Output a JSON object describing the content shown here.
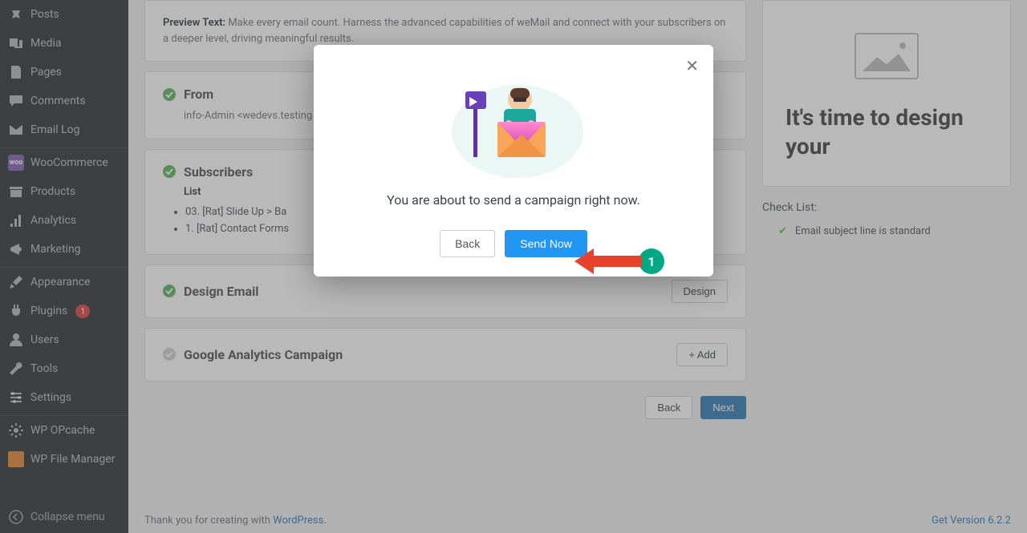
{
  "sidebar": {
    "items": [
      {
        "label": "Posts",
        "icon": "pin"
      },
      {
        "label": "Media",
        "icon": "media"
      },
      {
        "label": "Pages",
        "icon": "page"
      },
      {
        "label": "Comments",
        "icon": "comment"
      },
      {
        "label": "Email Log",
        "icon": "email"
      }
    ],
    "items2": [
      {
        "label": "WooCommerce",
        "icon": "woo"
      },
      {
        "label": "Products",
        "icon": "archive"
      },
      {
        "label": "Analytics",
        "icon": "chart"
      },
      {
        "label": "Marketing",
        "icon": "mega"
      }
    ],
    "items3": [
      {
        "label": "Appearance",
        "icon": "brush"
      },
      {
        "label": "Plugins",
        "icon": "plug",
        "badge": "1"
      },
      {
        "label": "Users",
        "icon": "user"
      },
      {
        "label": "Tools",
        "icon": "wrench"
      },
      {
        "label": "Settings",
        "icon": "sliders"
      }
    ],
    "items4": [
      {
        "label": "WP OPcache",
        "icon": "gear"
      },
      {
        "label": "WP File Manager",
        "icon": "folder"
      }
    ],
    "collapse": "Collapse menu"
  },
  "preview_card": {
    "label": "Preview Text:",
    "text": "Make every email count. Harness the advanced capabilities of weMail and connect with your subscribers on a deeper level, driving meaningful results."
  },
  "from_card": {
    "title": "From",
    "value": "info-Admin <wedevs.testing"
  },
  "subs_card": {
    "title": "Subscribers",
    "list_label": "List",
    "items": [
      "03. [Rat] Slide Up > Ba",
      "1. [Rat] Contact Forms"
    ]
  },
  "design_card": {
    "title": "Design Email",
    "button": "Design"
  },
  "ga_card": {
    "title": "Google Analytics Campaign",
    "button": "+ Add"
  },
  "nav": {
    "back": "Back",
    "next": "Next"
  },
  "side_preview": {
    "title": "It's time to design your"
  },
  "checklist": {
    "title": "Check List:",
    "item1": "Email subject line is standard"
  },
  "footer": {
    "thanks": "Thank you for creating with ",
    "wp": "WordPress",
    "version": "Get Version 6.2.2"
  },
  "modal": {
    "text": "You are about to send a campaign right now.",
    "back": "Back",
    "send": "Send Now"
  },
  "annotation": {
    "num": "1"
  }
}
